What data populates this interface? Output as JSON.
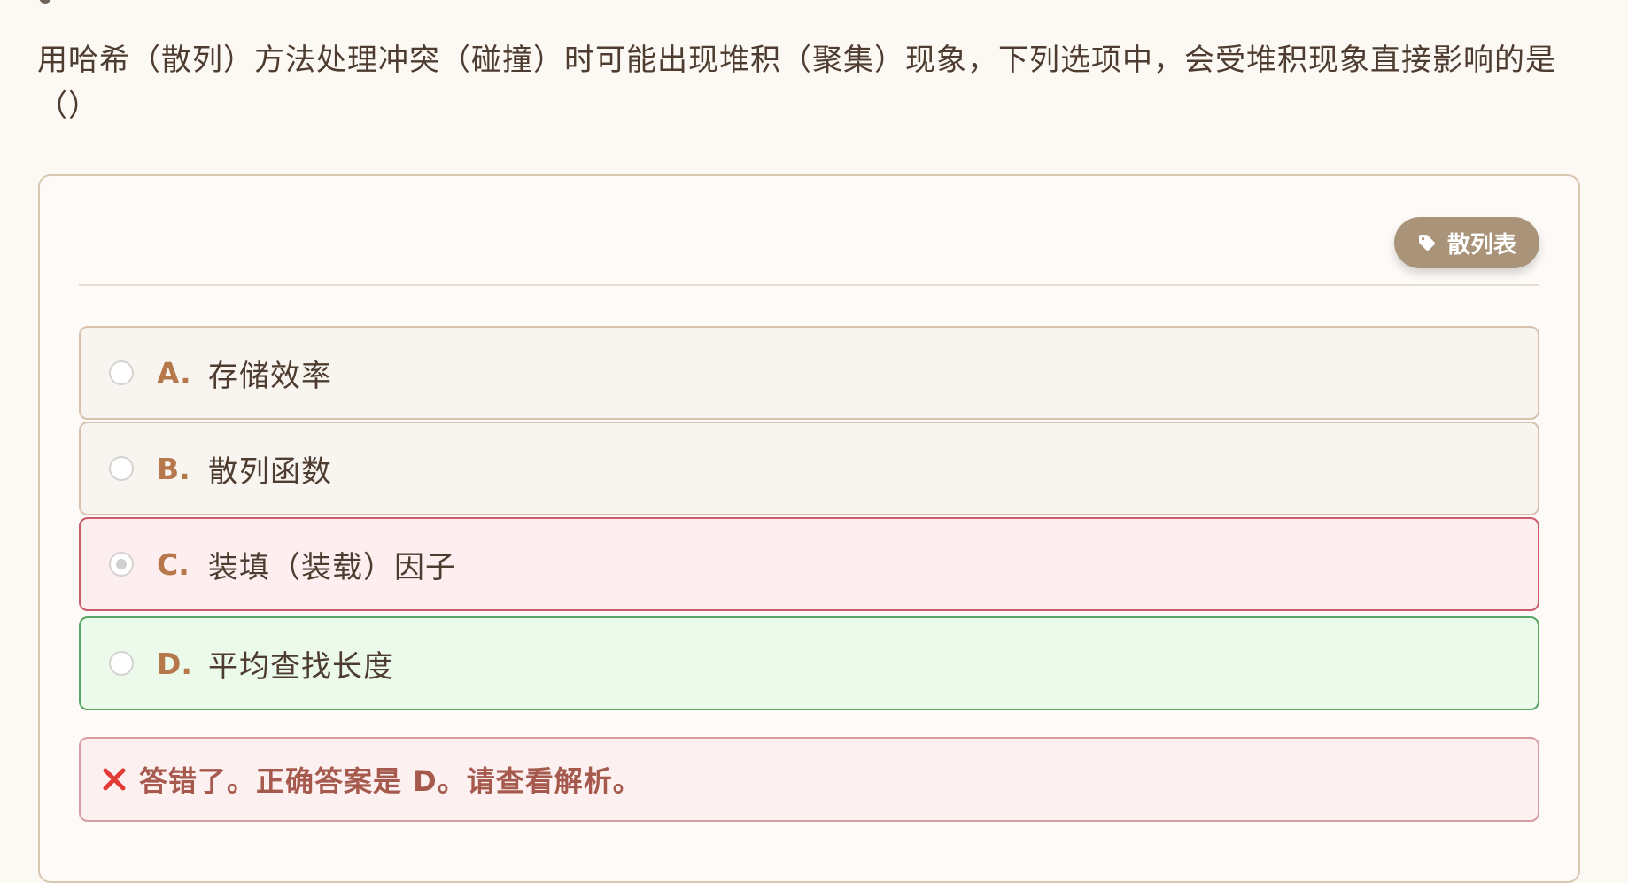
{
  "question": {
    "text": "用哈希（散列）方法处理冲突（碰撞）时可能出现堆积（聚集）现象，下列选项中，会受堆积现象直接影响的是\n（）"
  },
  "tag": {
    "label": "散列表",
    "icon": "tag-icon"
  },
  "options": [
    {
      "letter": "A.",
      "text": "存储效率",
      "state": "normal"
    },
    {
      "letter": "B.",
      "text": "散列函数",
      "state": "normal"
    },
    {
      "letter": "C.",
      "text": "装填（装载）因子",
      "state": "selected-wrong"
    },
    {
      "letter": "D.",
      "text": "平均查找长度",
      "state": "correct"
    }
  ],
  "feedback": {
    "icon": "close-icon",
    "text": "答错了。正确答案是 D。请查看解析。"
  },
  "colors": {
    "background": "#fcf9f5",
    "accent": "#b6784b",
    "wrong_border": "#c85a69",
    "correct_border": "#58a663",
    "feedback_text": "#a55a4d"
  }
}
